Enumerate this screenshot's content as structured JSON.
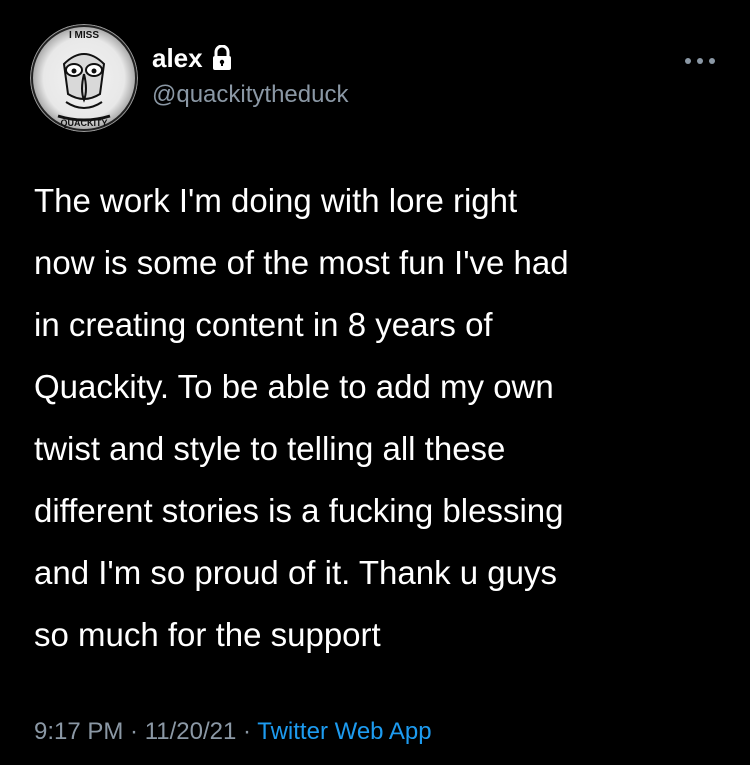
{
  "user": {
    "display_name": "alex",
    "handle": "@quackitytheduck",
    "protected_icon": "lock-icon",
    "avatar_top_text": "I MISS",
    "avatar_bottom_text": "QUACKITY"
  },
  "tweet": {
    "text": "The work I'm doing with lore right\nnow is some of the most fun I've had\nin creating content in 8 years of\nQuackity. To be able to add my own\ntwist and style to telling all these\ndifferent stories is a fucking blessing\nand I'm so proud of it. Thank u guys\nso much for the support",
    "time": "9:17 PM",
    "separator": " · ",
    "date": "11/20/21",
    "source": "Twitter Web App"
  },
  "icons": {
    "more": "more-options-icon"
  },
  "colors": {
    "background": "#000000",
    "primary_text": "#ffffff",
    "secondary_text": "#8b98a5",
    "link": "#1d9bf0"
  }
}
